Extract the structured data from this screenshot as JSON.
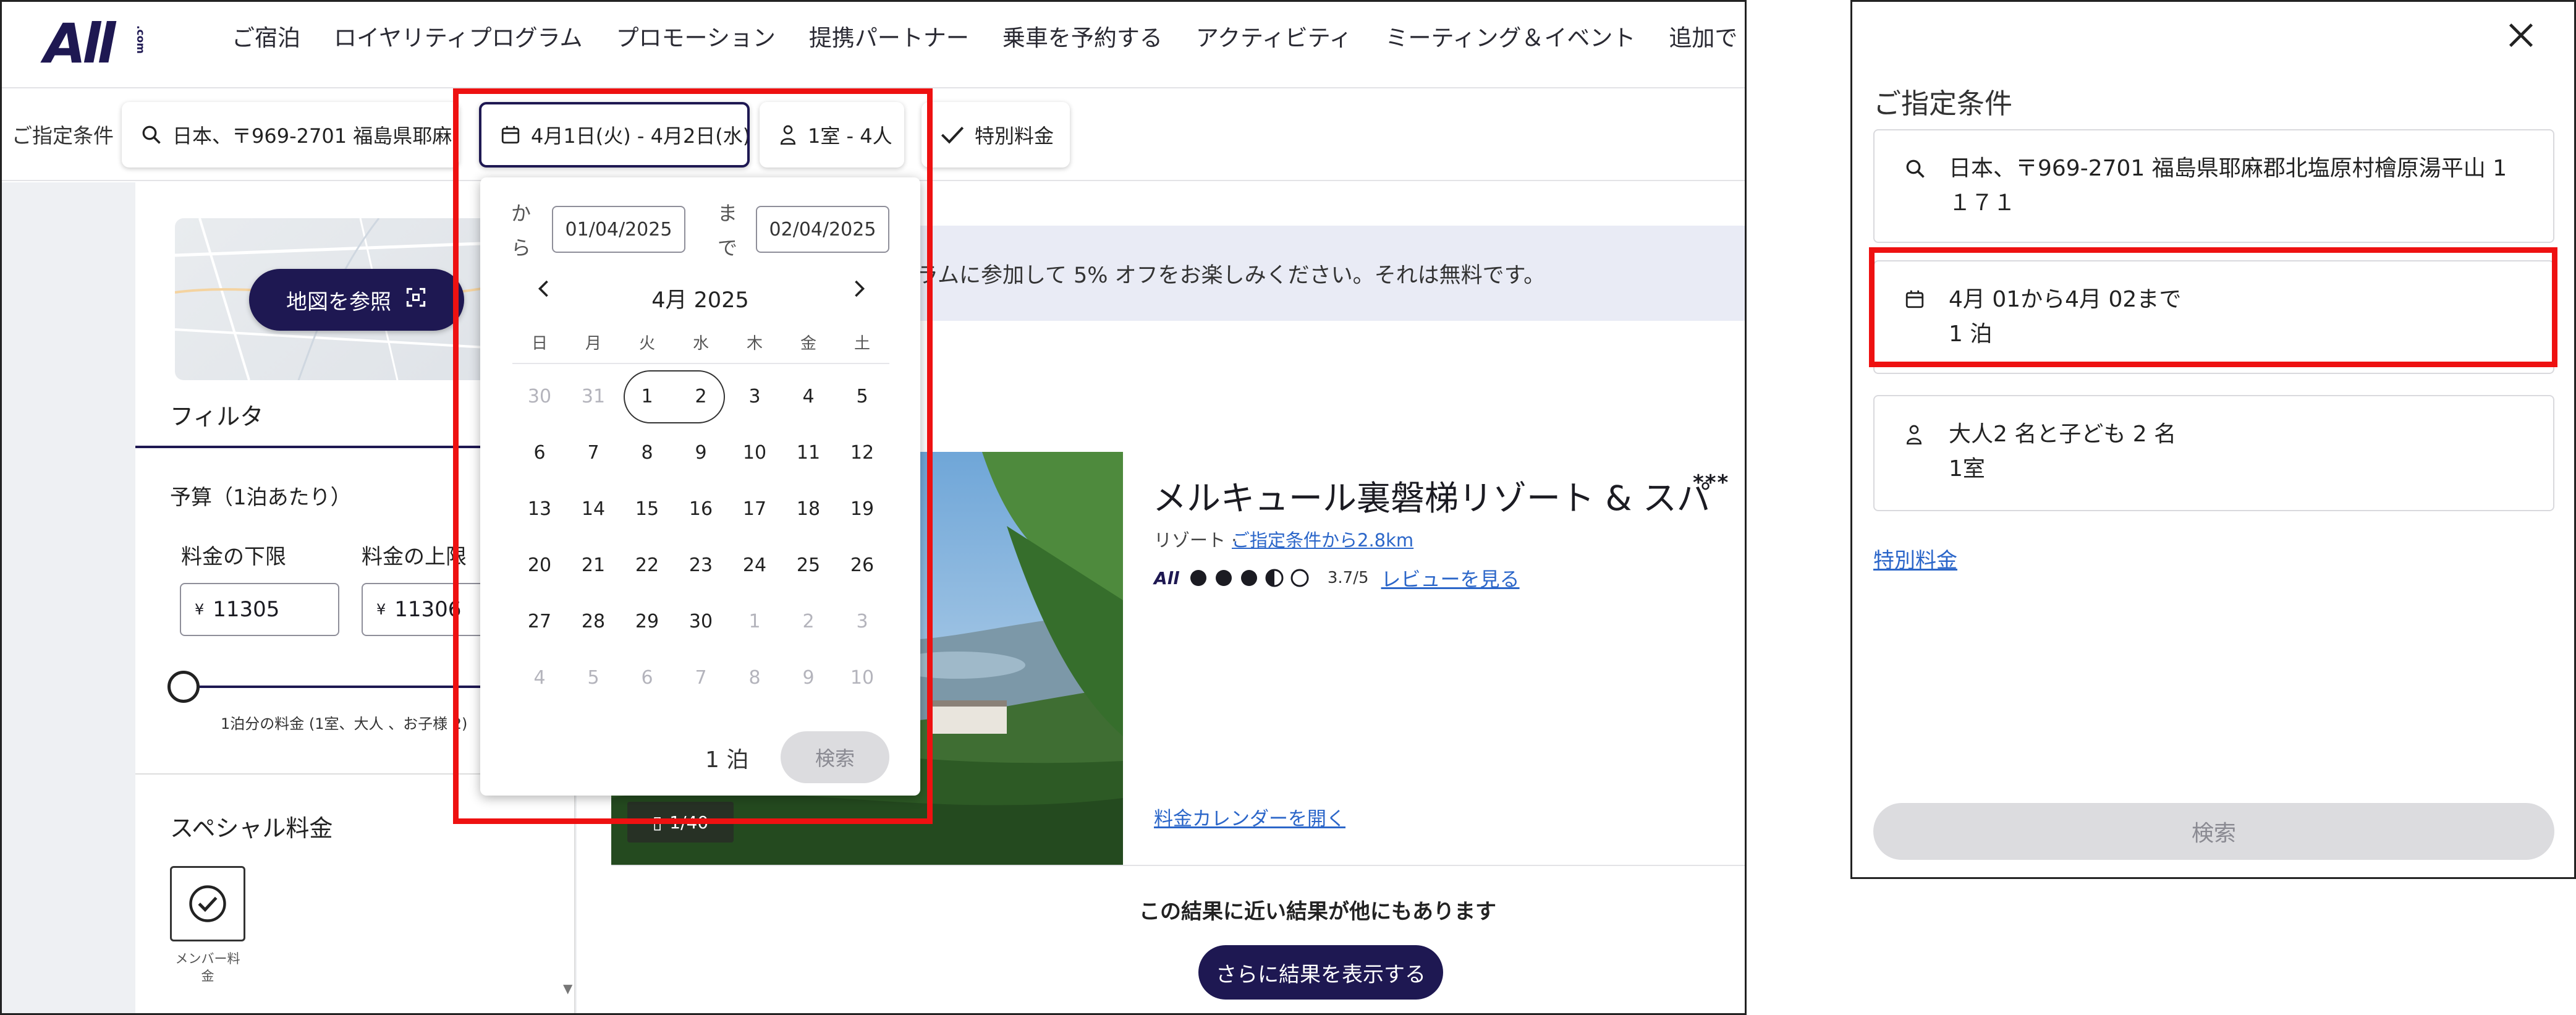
{
  "nav": {
    "logo": "All",
    "logo_suffix": ".com",
    "items": [
      "ご宿泊",
      "ロイヤリティプログラム",
      "プロモーション",
      "提携パートナー",
      "乗車を予約する",
      "アクティビティ",
      "ミーティング＆イベント",
      "追加で"
    ],
    "more_glyph": "⋮"
  },
  "criteria": {
    "label": "ご指定条件",
    "location": "日本、〒969-2701 福島県耶麻...",
    "dates": "4月1日(火) - 4月2日(水)",
    "guests": "1室 - 4人",
    "special": "特別料金"
  },
  "sidebar": {
    "map_button": "地図を参照",
    "filter_title": "フィルタ",
    "budget_title": "予算（1泊あたり）",
    "min_label": "料金の下限",
    "max_label": "料金の上限",
    "currency": "¥",
    "min_value": "11305",
    "max_value": "11306",
    "slider_note": "1泊分の料金 (1室、大人 、お子様 2)",
    "special_title": "スペシャル料金",
    "member_label": "メンバー料金"
  },
  "promo": {
    "text": "ラムに参加して 5% オフをお楽しみください。それは無料です。"
  },
  "hotel": {
    "name": "メルキュール裏磐梯リゾート & スパ",
    "stars": "***",
    "type": "リゾート · ",
    "distance": "ご指定条件から2.8km",
    "rating_brand": "All",
    "rating_score": "3.7/5",
    "reviews": "レビューを見る",
    "image_counter": "1/40",
    "price_calendar": "料金カレンダーを開く"
  },
  "results": {
    "near_text": "この結果に近い結果が他にもあります",
    "more_button": "さらに結果を表示する"
  },
  "calendar": {
    "from_label": "から",
    "to_label": "まで",
    "from_date": "01/04/2025",
    "to_date": "02/04/2025",
    "month_title": "4月 2025",
    "weekdays": [
      "日",
      "月",
      "火",
      "水",
      "木",
      "金",
      "土"
    ],
    "weeks": [
      [
        "30",
        "31",
        "1",
        "2",
        "3",
        "4",
        "5"
      ],
      [
        "6",
        "7",
        "8",
        "9",
        "10",
        "11",
        "12"
      ],
      [
        "13",
        "14",
        "15",
        "16",
        "17",
        "18",
        "19"
      ],
      [
        "20",
        "21",
        "22",
        "23",
        "24",
        "25",
        "26"
      ],
      [
        "27",
        "28",
        "29",
        "30",
        "1",
        "2",
        "3"
      ],
      [
        "4",
        "5",
        "6",
        "7",
        "8",
        "9",
        "10"
      ]
    ],
    "nights": "1 泊",
    "search": "検索"
  },
  "panel": {
    "title": "ご指定条件",
    "location_line1": "日本、〒969-2701 福島県耶麻郡北塩原村檜原湯平山 1",
    "location_line2": "１７１",
    "dates_line1": "4月 01から4月 02まで",
    "dates_line2": "1 泊",
    "guests_line1": "大人2 名と子ども 2 名",
    "guests_line2": "1室",
    "special": "特別料金",
    "search": "検索"
  },
  "colors": {
    "brand": "#1e1852",
    "link": "#2b66c9",
    "highlight": "#ee1111"
  }
}
